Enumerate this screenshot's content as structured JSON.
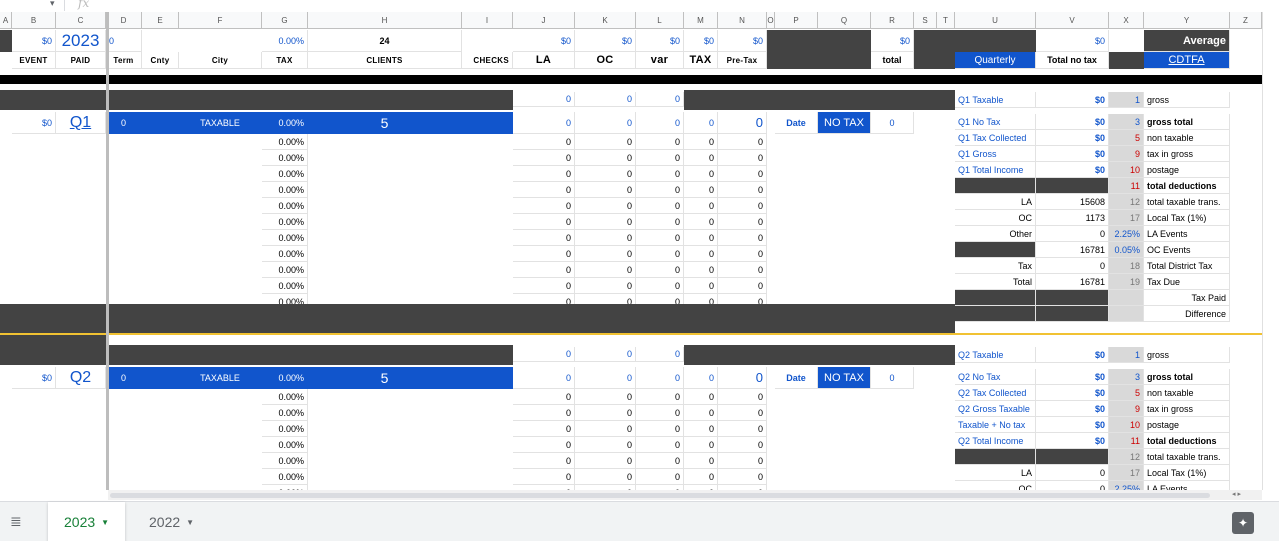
{
  "columns": [
    "A",
    "B",
    "C",
    "D",
    "E",
    "F",
    "G",
    "H",
    "I",
    "J",
    "K",
    "L",
    "M",
    "N",
    "O",
    "P",
    "Q",
    "R",
    "S",
    "T",
    "U",
    "V",
    "X",
    "Y",
    "Z"
  ],
  "header": {
    "row1": {
      "b": "$0",
      "c": "2023",
      "d": "0",
      "g": "0.00%",
      "h": "24",
      "j": "$0",
      "k": "$0",
      "l": "$0",
      "m": "$0",
      "n": "$0",
      "r": "$0",
      "v": "$0",
      "y": "Average"
    },
    "row2": {
      "b": "EVENT",
      "c": "PAID",
      "d": "Term",
      "e": "Cnty",
      "f": "City",
      "g": "TAX",
      "h": "CLIENTS",
      "i": "CHECKS",
      "j": "LA",
      "k": "OC",
      "l": "var",
      "m": "TAX",
      "n": "Pre-Tax",
      "r": "total",
      "u": "Quarterly",
      "v": "Total no tax",
      "y": "CDTFA"
    }
  },
  "q1": {
    "summary_row": {
      "j": "0",
      "k": "0",
      "l": "0"
    },
    "event": "$0",
    "label": "Q1",
    "d": "0",
    "type": "TAXABLE",
    "pct": "0.00%",
    "clients": "5",
    "j": "0",
    "k": "0",
    "l": "0",
    "m": "0",
    "n": "0",
    "date_label": "Date",
    "notax_label": "NO TAX",
    "notax_value": "0",
    "row_pct": "0.00%",
    "row_zero": "0",
    "side": [
      {
        "label": "Q1 Taxable",
        "value": "$0",
        "num": "1",
        "desc": "gross"
      },
      {
        "label": "Q1 No Tax",
        "value": "$0",
        "num": "3",
        "desc": "gross total"
      },
      {
        "label": "Q1 Tax Collected",
        "value": "$0",
        "num": "5",
        "desc": "non taxable"
      },
      {
        "label": "Q1 Gross",
        "value": "$0",
        "num": "9",
        "desc": "tax in gross"
      },
      {
        "label": "Q1 Total Income",
        "value": "$0",
        "num": "10",
        "desc": "postage"
      },
      {
        "label": "",
        "value": "",
        "num": "11",
        "desc": "total deductions"
      },
      {
        "label": "LA",
        "value": "15608",
        "num": "12",
        "desc": "total taxable trans."
      },
      {
        "label": "OC",
        "value": "1173",
        "num": "17",
        "desc": "Local Tax (1%)"
      },
      {
        "label": "Other",
        "value": "0",
        "num": "2.25%",
        "desc": "LA Events"
      },
      {
        "label": "",
        "value": "16781",
        "num": "0.05%",
        "desc": "OC Events"
      },
      {
        "label": "Tax",
        "value": "0",
        "num": "18",
        "desc": "Total District Tax"
      },
      {
        "label": "Total",
        "value": "16781",
        "num": "19",
        "desc": "Tax Due"
      },
      {
        "label": "",
        "value": "",
        "num": "",
        "desc": "Tax Paid"
      },
      {
        "label": "",
        "value": "",
        "num": "",
        "desc": "Difference"
      }
    ]
  },
  "q2": {
    "summary_row": {
      "j": "0",
      "k": "0",
      "l": "0"
    },
    "event": "$0",
    "label": "Q2",
    "d": "0",
    "type": "TAXABLE",
    "pct": "0.00%",
    "clients": "5",
    "j": "0",
    "k": "0",
    "l": "0",
    "m": "0",
    "n": "0",
    "date_label": "Date",
    "notax_label": "NO TAX",
    "notax_value": "0",
    "row_pct": "0.00%",
    "row_zero": "0",
    "side": [
      {
        "label": "Q2 Taxable",
        "value": "$0",
        "num": "1",
        "desc": "gross"
      },
      {
        "label": "Q2 No Tax",
        "value": "$0",
        "num": "3",
        "desc": "gross total"
      },
      {
        "label": "Q2 Tax Collected",
        "value": "$0",
        "num": "5",
        "desc": "non taxable"
      },
      {
        "label": "Q2 Gross Taxable",
        "value": "$0",
        "num": "9",
        "desc": "tax in gross"
      },
      {
        "label": "Taxable + No tax",
        "value": "$0",
        "num": "10",
        "desc": "postage"
      },
      {
        "label": "Q2 Total Income",
        "value": "$0",
        "num": "11",
        "desc": "total deductions"
      },
      {
        "label": "",
        "value": "",
        "num": "12",
        "desc": "total taxable trans."
      },
      {
        "label": "LA",
        "value": "0",
        "num": "17",
        "desc": "Local Tax (1%)"
      },
      {
        "label": "OC",
        "value": "0",
        "num": "2.25%",
        "desc": "LA Events"
      }
    ]
  },
  "tabs": [
    {
      "label": "2023",
      "active": true
    },
    {
      "label": "2022",
      "active": false
    }
  ]
}
